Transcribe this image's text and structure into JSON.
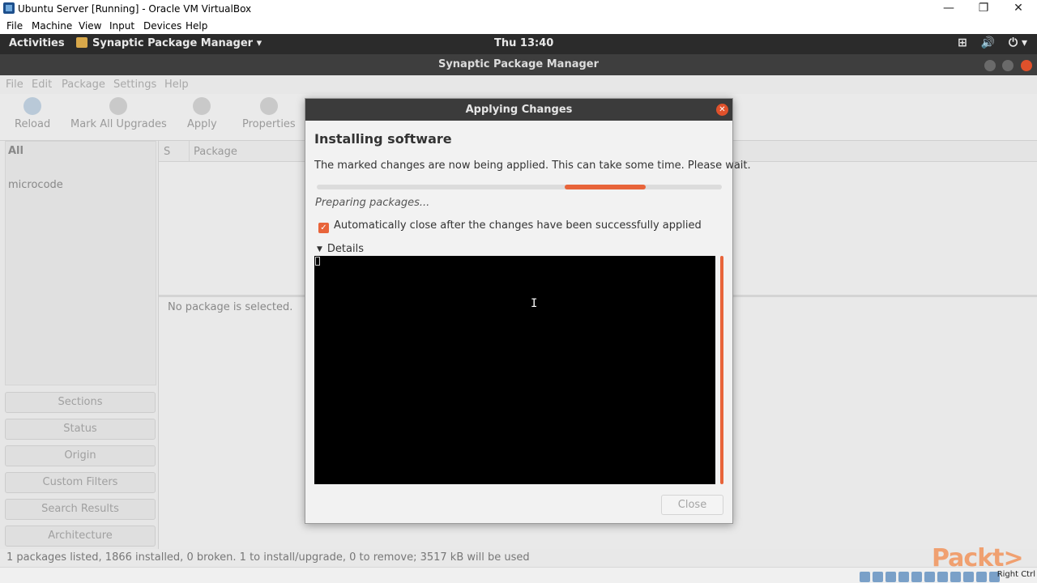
{
  "host": {
    "window_title": "Ubuntu Server [Running] - Oracle VM VirtualBox",
    "controls": {
      "minimize": "—",
      "restore": "❐",
      "close": "✕"
    },
    "menu": [
      "File",
      "Machine",
      "View",
      "Input",
      "Devices",
      "Help"
    ],
    "host_key": "Right Ctrl",
    "watermark": "Packt>"
  },
  "gnome": {
    "activities": "Activities",
    "app_menu": "Synaptic Package Manager ▾",
    "clock": "Thu 13:40",
    "tray": {
      "network": "⊞",
      "volume": "🔊",
      "power": "⏻ ▾"
    }
  },
  "synaptic": {
    "title": "Synaptic Package Manager",
    "menu": [
      "File",
      "Edit",
      "Package",
      "Settings",
      "Help"
    ],
    "toolbar": [
      "Reload",
      "Mark All Upgrades",
      "Apply",
      "Properties"
    ],
    "categories": {
      "all": "All",
      "item": "microcode"
    },
    "filters": [
      "Sections",
      "Status",
      "Origin",
      "Custom Filters",
      "Search Results",
      "Architecture"
    ],
    "columns": {
      "status": "S",
      "package": "Package"
    },
    "no_selection": "No package is selected.",
    "status_bar": "1 packages listed, 1866 installed, 0 broken. 1 to install/upgrade, 0 to remove; 3517 kB will be used"
  },
  "dialog": {
    "title": "Applying Changes",
    "heading": "Installing software",
    "description": "The marked changes are now being applied. This can take some time. Please wait.",
    "status": "Preparing packages...",
    "auto_close_label": "Automatically close after the changes have been successfully applied",
    "auto_close_checked": true,
    "details_label": "Details",
    "close_label": "Close",
    "accent_color": "#e8643a"
  }
}
